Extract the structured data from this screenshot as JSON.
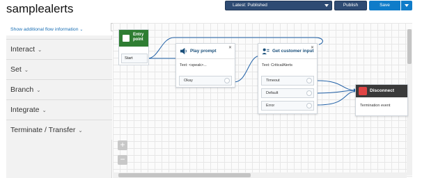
{
  "app": {
    "title": "samplealerts"
  },
  "header": {
    "version_select": "Latest: Published",
    "publish_label": "Publish",
    "save_label": "Save"
  },
  "sidebar": {
    "show_info_label": "Show additional flow information",
    "collapse_glyph": "◂",
    "categories": [
      {
        "label": "Interact"
      },
      {
        "label": "Set"
      },
      {
        "label": "Branch"
      },
      {
        "label": "Integrate"
      },
      {
        "label": "Terminate / Transfer"
      }
    ]
  },
  "canvas": {
    "zoom_in": "+",
    "zoom_out": "−",
    "blocks": {
      "entry": {
        "title": "Entry point",
        "branch": "Start",
        "color": "#2e7d32"
      },
      "play_prompt": {
        "title": "Play prompt",
        "text": "Text: <speak>...",
        "branch": "Okay"
      },
      "get_input": {
        "title": "Get customer input",
        "text": "Text: CriticalAlerts",
        "branches": [
          "Timeout",
          "Default",
          "Error"
        ]
      },
      "disconnect": {
        "title": "Disconnect",
        "text": "Termination event"
      }
    }
  },
  "colors": {
    "accent": "#0f7cc9",
    "nav": "#2e4b73",
    "wire": "#1f5fa6"
  }
}
